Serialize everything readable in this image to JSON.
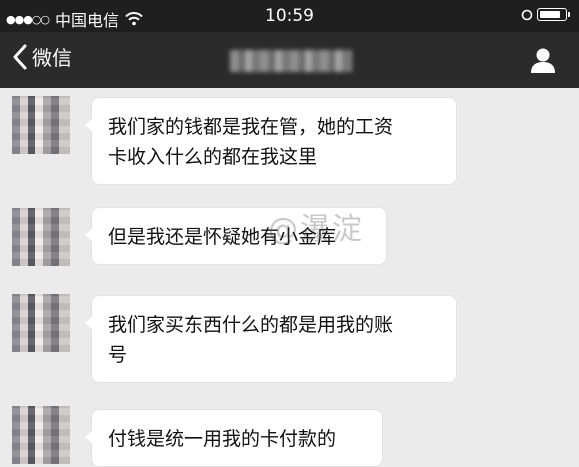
{
  "status_bar": {
    "signal": "●●●○○",
    "carrier": "中国电信",
    "time": "10:59"
  },
  "nav": {
    "back_label": "微信",
    "icons": {
      "back": "chevron-left-icon",
      "contact": "person-icon"
    }
  },
  "messages": [
    {
      "text": "我们家的钱都是我在管，她的工资\n卡收入什么的都在我这里"
    },
    {
      "text": "但是我还是怀疑她有小金库"
    },
    {
      "text": "我们家买东西什么的都是用我的账\n号"
    },
    {
      "text": "付钱是统一用我的卡付款的"
    }
  ],
  "watermark": "@瀑淀",
  "colors": {
    "statusbar_bg": "#1f1f1f",
    "navbar_bg": "#2b2b2b",
    "chat_bg": "#ebebeb",
    "bubble_bg": "#ffffff"
  }
}
